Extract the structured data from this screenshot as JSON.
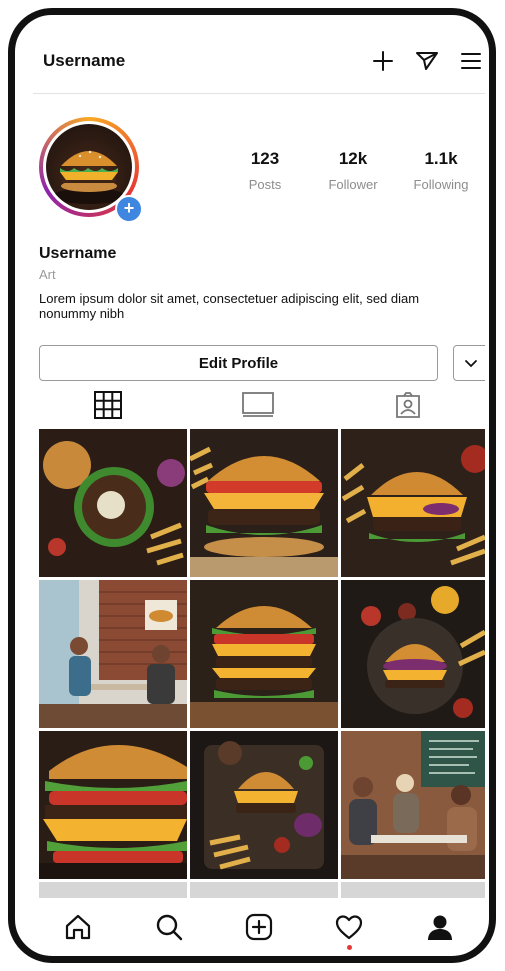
{
  "header": {
    "username": "Username",
    "icons": [
      "plus-icon",
      "send-icon",
      "menu-icon"
    ]
  },
  "profile": {
    "stats": [
      {
        "value": "123",
        "label": "Posts"
      },
      {
        "value": "12k",
        "label": "Follower"
      },
      {
        "value": "1.1k",
        "label": "Following"
      }
    ],
    "name": "Username",
    "category": "Art",
    "bio": "Lorem ipsum dolor sit amet, consectetuer adipiscing elit, sed diam nonummy nibh",
    "edit_button": "Edit Profile"
  },
  "tabs": [
    "grid-icon",
    "reels-icon",
    "tagged-icon"
  ],
  "posts": [
    {
      "scene": "burger-top-view"
    },
    {
      "scene": "burger-cheese-fries"
    },
    {
      "scene": "burger-onion-sauce"
    },
    {
      "scene": "restaurant-people"
    },
    {
      "scene": "double-burger"
    },
    {
      "scene": "burger-plate-top"
    },
    {
      "scene": "burger-closeup"
    },
    {
      "scene": "burger-board-fries"
    },
    {
      "scene": "cafe-friends"
    }
  ],
  "bottom_nav": [
    "home-icon",
    "search-icon",
    "create-icon",
    "heart-icon",
    "profile-icon"
  ],
  "colors": {
    "accent_blue": "#3f86e0",
    "notification_dot": "#e53935"
  }
}
